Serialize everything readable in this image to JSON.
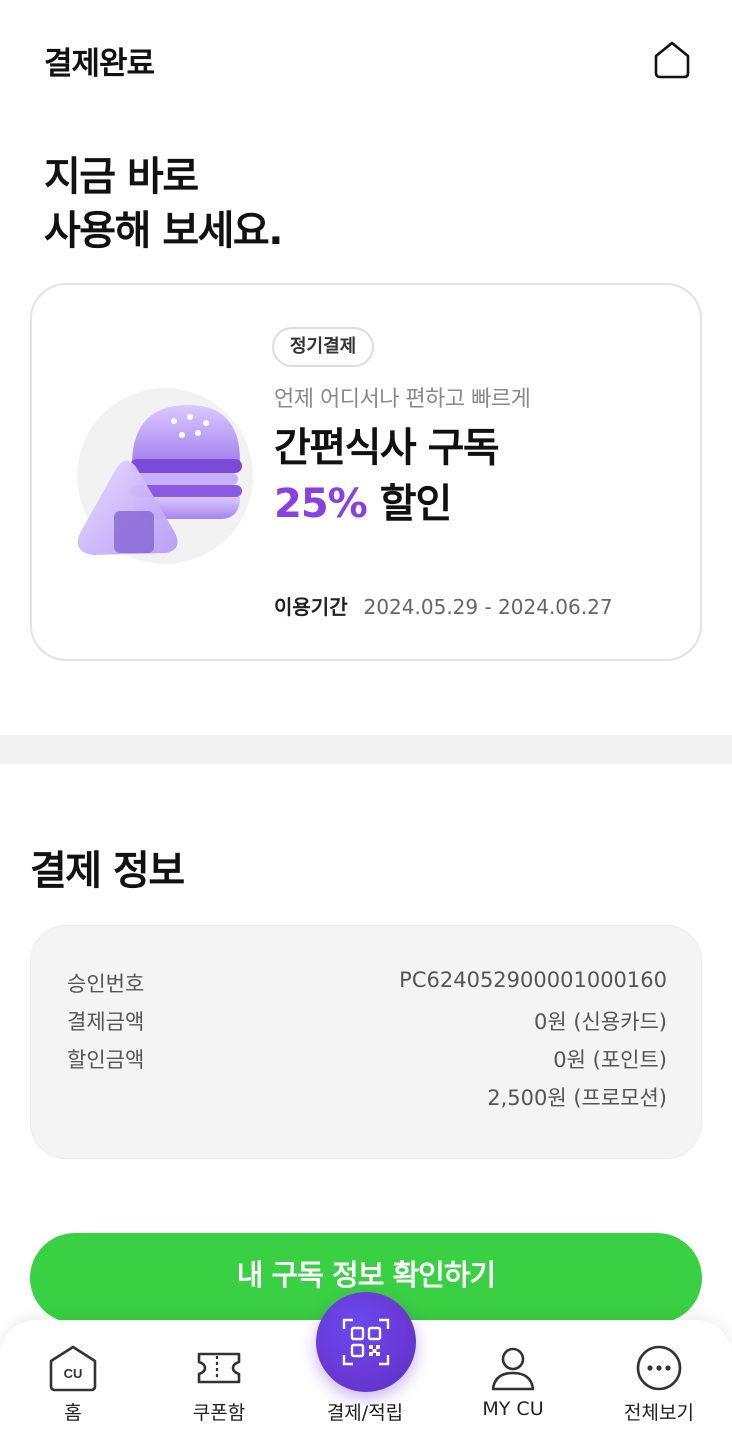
{
  "header": {
    "title": "결제완료"
  },
  "hero": {
    "line1": "지금 바로",
    "line2": "사용해 보세요."
  },
  "promo": {
    "badge": "정기결제",
    "subtitle": "언제 어디서나 편하고 빠르게",
    "title": "간편식사 구독",
    "discount_pct": "25%",
    "discount_word": "할인",
    "period_label": "이용기간",
    "period_value": "2024.05.29 - 2024.06.27"
  },
  "payment": {
    "section_title": "결제 정보",
    "rows": [
      {
        "key": "승인번호",
        "value": "PC624052900001000160"
      },
      {
        "key": "결제금액",
        "value": "0원 (신용카드)"
      },
      {
        "key": "할인금액",
        "value": "0원 (포인트)"
      },
      {
        "key": "",
        "value": "2,500원 (프로모션)"
      }
    ]
  },
  "cta": {
    "label": "내 구독 정보 확인하기"
  },
  "tabbar": {
    "items": [
      {
        "label": "홈",
        "icon": "cu-home-icon"
      },
      {
        "label": "쿠폰함",
        "icon": "ticket-icon"
      },
      {
        "label": "결제/적립",
        "icon": "qr-code-icon"
      },
      {
        "label": "MY CU",
        "icon": "person-icon"
      },
      {
        "label": "전체보기",
        "icon": "more-icon"
      }
    ],
    "home_icon_text": "CU"
  },
  "colors": {
    "accent_green": "#3ad043",
    "accent_purple": "#8a3fe0",
    "fab_purple": "#6a39d6"
  }
}
